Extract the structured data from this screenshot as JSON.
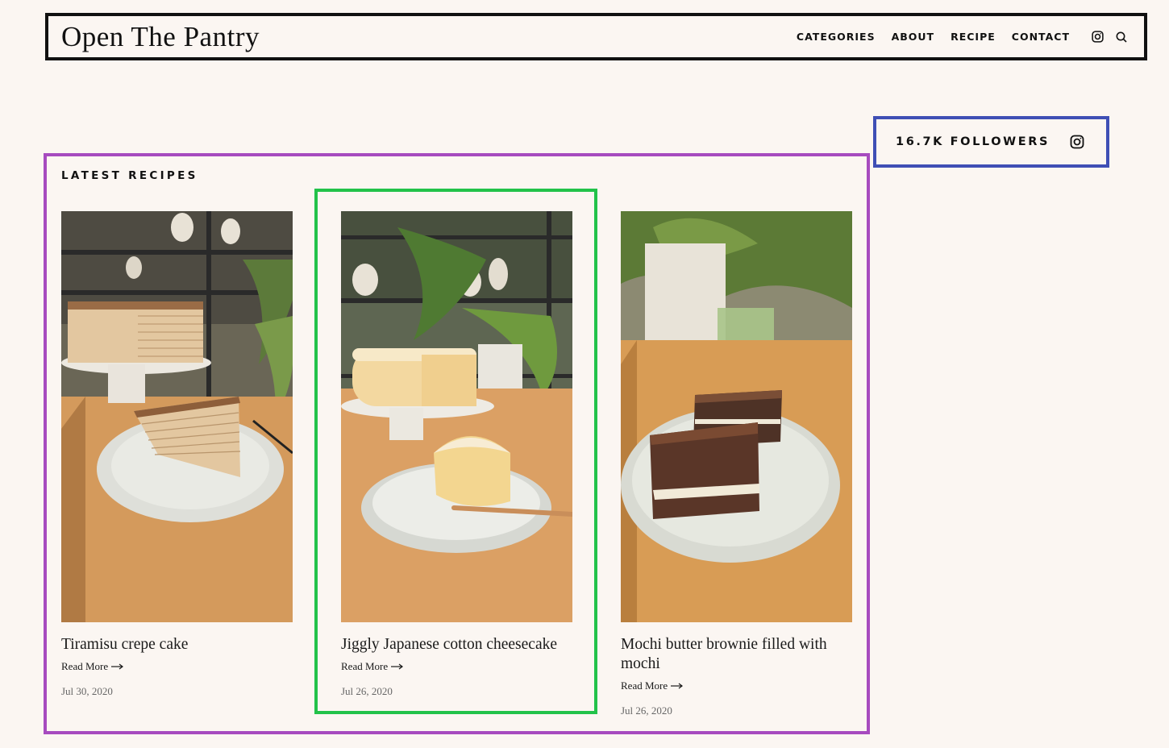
{
  "header": {
    "brand": "Open The Pantry",
    "nav": [
      "CATEGORIES",
      "ABOUT",
      "RECIPE",
      "CONTACT"
    ],
    "icons": [
      "instagram-icon",
      "search-icon"
    ]
  },
  "followers": {
    "label": "16.7K FOLLOWERS",
    "icon": "instagram-icon"
  },
  "latest": {
    "title": "LATEST RECIPES",
    "cards": [
      {
        "title": "Tiramisu crepe cake",
        "read_more": "Read More",
        "date": "Jul 30, 2020"
      },
      {
        "title": "Jiggly Japanese cotton cheesecake",
        "read_more": "Read More",
        "date": "Jul 26, 2020"
      },
      {
        "title": "Mochi butter brownie filled with mochi",
        "read_more": "Read More",
        "date": "Jul 26, 2020"
      }
    ]
  },
  "colors": {
    "background": "#fbf6f2",
    "header_border": "#111111",
    "followers_border": "#3f4fb5",
    "section_border": "#a74bbf",
    "highlight_border": "#22c24a"
  }
}
